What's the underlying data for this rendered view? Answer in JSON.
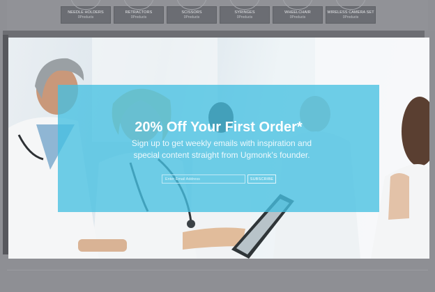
{
  "categories": [
    {
      "name": "NEEDLE HOLDERS",
      "count": "0Products"
    },
    {
      "name": "RETRACTORS",
      "count": "0Products"
    },
    {
      "name": "SCISSORS",
      "count": "0Products"
    },
    {
      "name": "SYRINGES",
      "count": "0Products"
    },
    {
      "name": "WHEELCHAIR",
      "count": "0Products"
    },
    {
      "name": "WIRELESS CAMERA SET",
      "count": "0Products"
    }
  ],
  "promo": {
    "title": "20% Off Your First Order*",
    "subtitle": "Sign up to get weekly emails with inspiration and special content straight from Ugmonk's founder.",
    "email_placeholder": "Enter Email Address",
    "subscribe_label": "SUBSCRIBE"
  },
  "colors": {
    "overlay": "#46c0e2",
    "page_background": "#8e8f94"
  }
}
